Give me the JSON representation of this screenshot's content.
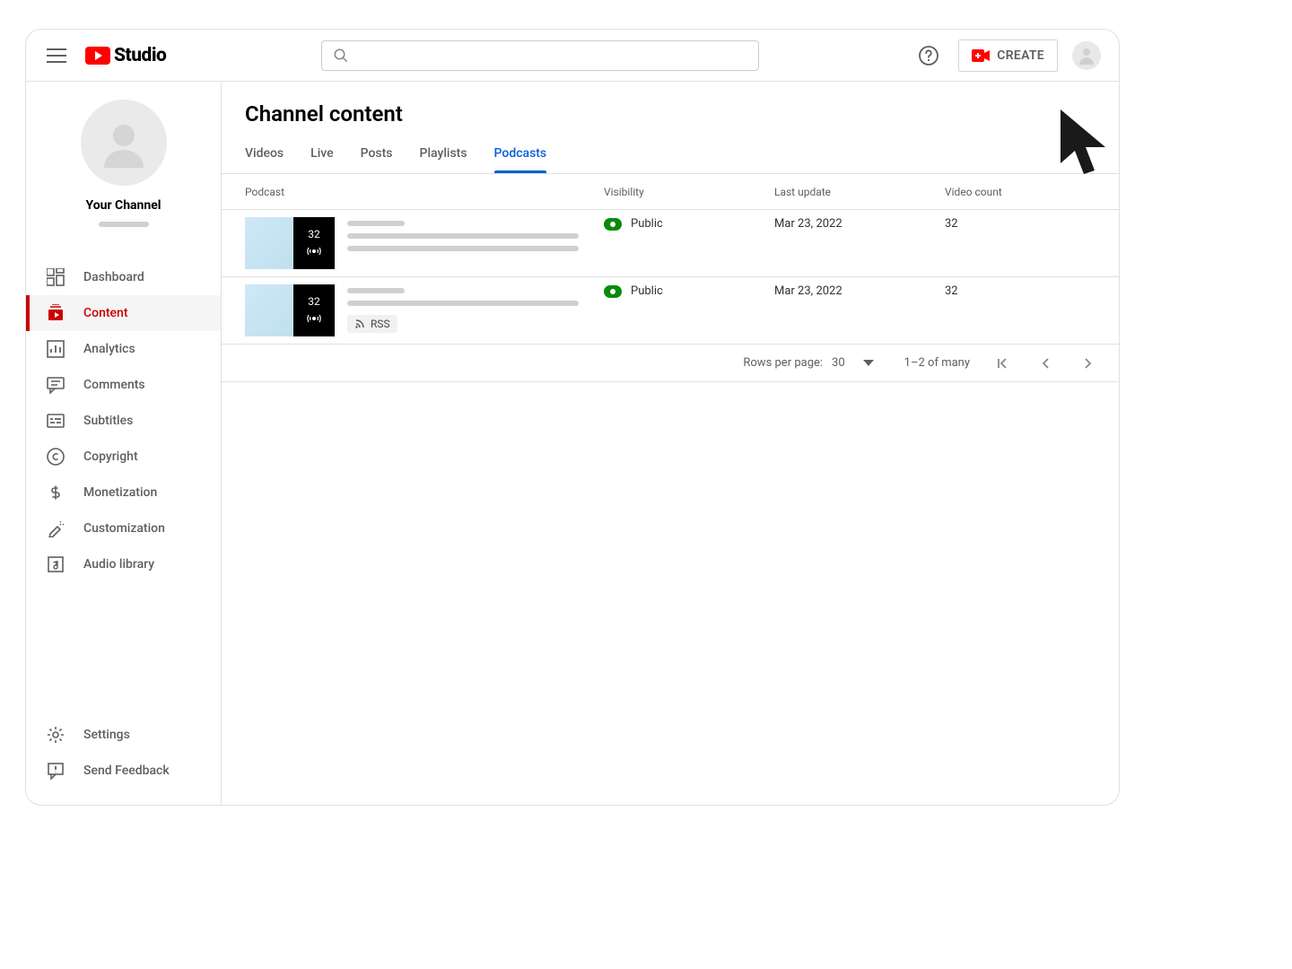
{
  "app": {
    "brand": "Studio"
  },
  "header": {
    "create_label": "CREATE",
    "search_placeholder": ""
  },
  "sidebar": {
    "channel_name": "Your Channel",
    "items": [
      {
        "label": "Dashboard"
      },
      {
        "label": "Content"
      },
      {
        "label": "Analytics"
      },
      {
        "label": "Comments"
      },
      {
        "label": "Subtitles"
      },
      {
        "label": "Copyright"
      },
      {
        "label": "Monetization"
      },
      {
        "label": "Customization"
      },
      {
        "label": "Audio library"
      }
    ],
    "bottom": [
      {
        "label": "Settings"
      },
      {
        "label": "Send Feedback"
      }
    ]
  },
  "main": {
    "title": "Channel content",
    "tabs": [
      {
        "label": "Videos"
      },
      {
        "label": "Live"
      },
      {
        "label": "Posts"
      },
      {
        "label": "Playlists"
      },
      {
        "label": "Podcasts",
        "active": true
      }
    ],
    "columns": {
      "podcast": "Podcast",
      "visibility": "Visibility",
      "last_update": "Last update",
      "video_count": "Video count"
    },
    "rows": [
      {
        "overlay_count": "32",
        "visibility": "Public",
        "last_update": "Mar 23, 2022",
        "video_count": "32",
        "has_rss": false
      },
      {
        "overlay_count": "32",
        "visibility": "Public",
        "last_update": "Mar 23, 2022",
        "video_count": "32",
        "has_rss": true,
        "rss_label": "RSS"
      }
    ],
    "pager": {
      "rows_per_page_label": "Rows per page:",
      "rows_per_page_value": "30",
      "range_label": "1–2 of many"
    }
  }
}
